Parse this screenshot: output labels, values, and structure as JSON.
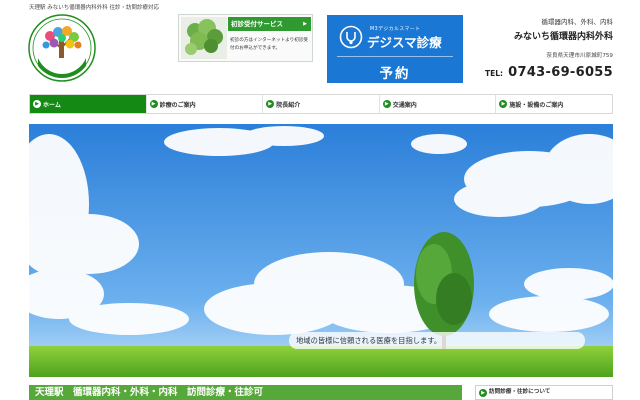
{
  "header": {
    "topline": "天理駅 みないち循環器内科外科 往診・訪問診療対応",
    "logo_text": "みないち循環器内科外科"
  },
  "first_visit": {
    "title": "初診受付サービス",
    "arrow": "▶",
    "text": "初診の方はインターネットより初診受付のお申込ができます。"
  },
  "digisma": {
    "sub": "M3デジカルスマート",
    "title": "デジスマ診療",
    "action": "予約"
  },
  "clinic": {
    "departments": "循環器内科、外科、内科",
    "name": "みないち循環器内科外科",
    "address": "奈良県天理市川原城町759",
    "tel_label": "TEL:",
    "tel": "0743-69-6055"
  },
  "nav": {
    "arrow": "▶",
    "items": [
      {
        "label": "ホーム",
        "active": true
      },
      {
        "label": "診療のご案内",
        "active": false
      },
      {
        "label": "院長紹介",
        "active": false
      },
      {
        "label": "交通案内",
        "active": false
      },
      {
        "label": "施設・設備のご案内",
        "active": false
      }
    ]
  },
  "hero": {
    "caption": "地域の皆様に信頼される医療を目指します。"
  },
  "bottom": {
    "headline": "天理駅　循環器内科・外科・内科　訪問診療・往診可",
    "side_title": "訪問診療・往診について"
  },
  "colors": {
    "brand_green": "#148a14",
    "digisma_blue": "#1a77d4",
    "bar_green": "#56a83a"
  }
}
